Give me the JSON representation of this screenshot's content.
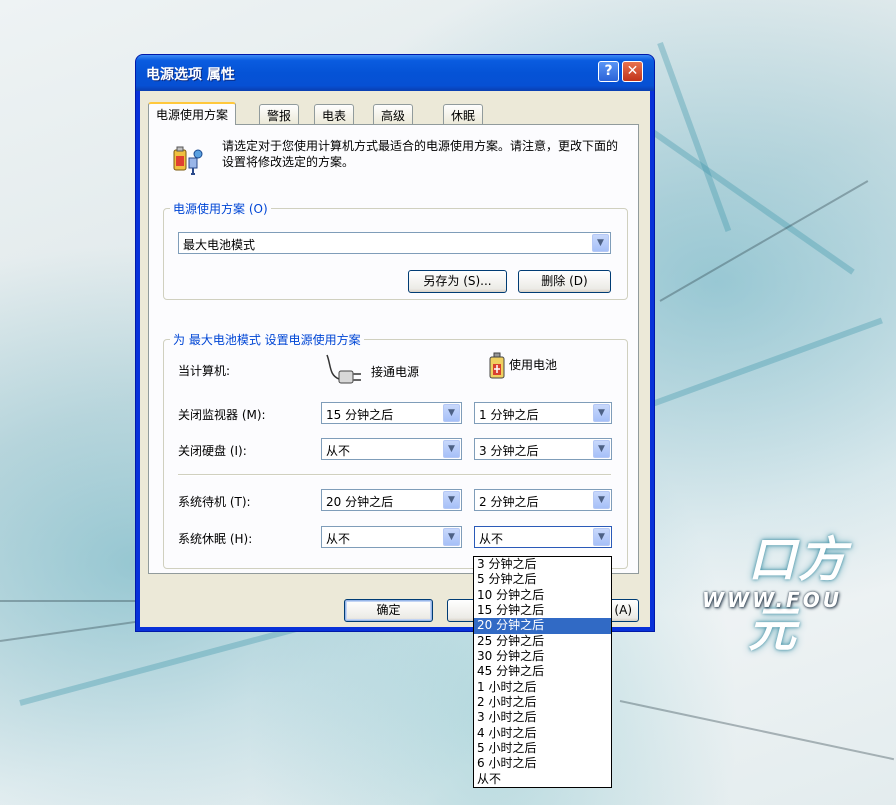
{
  "window": {
    "title": "电源选项 属性",
    "help_button": "?",
    "close_button": "✕"
  },
  "tabs": [
    {
      "label": "电源使用方案",
      "active": true
    },
    {
      "label": "警报"
    },
    {
      "label": "电表"
    },
    {
      "label": "高级"
    },
    {
      "label": "休眠"
    }
  ],
  "intro": {
    "text": "请选定对于您使用计算机方式最适合的电源使用方案。请注意，更改下面的设置将修改选定的方案。"
  },
  "scheme_group": {
    "legend": "电源使用方案 (O)",
    "selected": "最大电池模式",
    "save_as_label": "另存为 (S)...",
    "delete_label": "删除 (D)"
  },
  "settings_group": {
    "legend": "为 最大电池模式 设置电源使用方案",
    "when_label": "当计算机:",
    "ac_label": "接通电源",
    "battery_label": "使用电池",
    "rows": [
      {
        "label": "关闭监视器 (M):",
        "ac": "15 分钟之后",
        "battery": "1 分钟之后"
      },
      {
        "label": "关闭硬盘 (I):",
        "ac": "从不",
        "battery": "3 分钟之后"
      },
      {
        "label": "系统待机 (T):",
        "ac": "20 分钟之后",
        "battery": "2 分钟之后"
      },
      {
        "label": "系统休眠 (H):",
        "ac": "从不",
        "battery": "从不"
      }
    ]
  },
  "footer": {
    "ok_label": "确定",
    "apply_label": "(A)"
  },
  "dropdown_options": [
    "3 分钟之后",
    "5 分钟之后",
    "10 分钟之后",
    "15 分钟之后",
    "20 分钟之后",
    "25 分钟之后",
    "30 分钟之后",
    "45 分钟之后",
    "1 小时之后",
    "2 小时之后",
    "3 小时之后",
    "4 小时之后",
    "5 小时之后",
    "6 小时之后",
    "从不"
  ],
  "dropdown_highlighted": "20 分钟之后",
  "wallpaper": {
    "logo_text": "口方元",
    "url_text": "WWW.FOU"
  },
  "colors": {
    "titlebar": "#0553d6",
    "dialog_face": "#ece9d8",
    "legend_text": "#0046d5",
    "selection": "#316ac5"
  }
}
